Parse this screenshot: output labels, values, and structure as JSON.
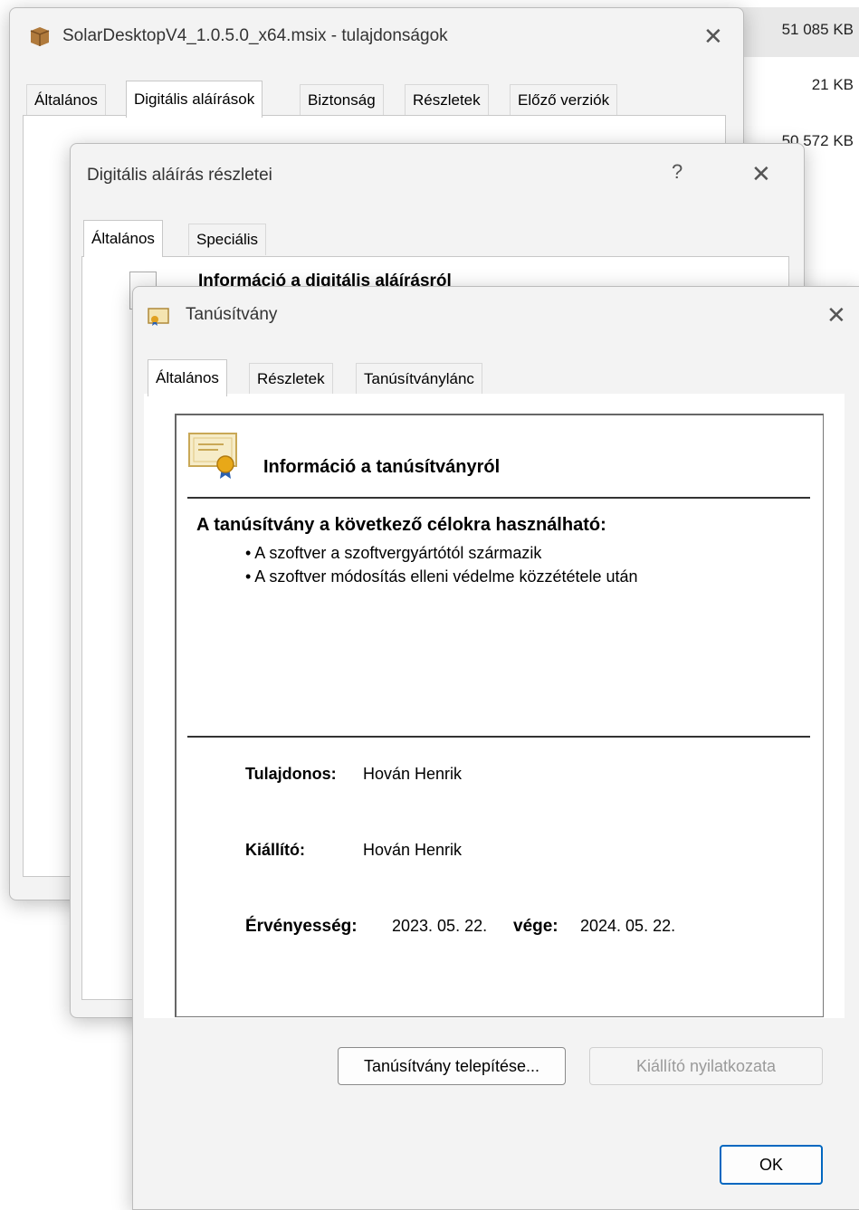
{
  "background_list": {
    "sizes": [
      "51 085 KB",
      "21 KB",
      "50 572 KB"
    ]
  },
  "props_window": {
    "title": "SolarDesktopV4_1.0.5.0_x64.msix - tulajdonságok",
    "tabs": [
      "Általános",
      "Digitális aláírások",
      "Biztonság",
      "Részletek",
      "Előző verziók"
    ],
    "active_tab": 1
  },
  "sig_window": {
    "title": "Digitális aláírás részletei",
    "help": "?",
    "tabs": [
      "Általános",
      "Speciális"
    ],
    "heading": "Információ a digitális aláírásról"
  },
  "cert_window": {
    "title": "Tanúsítvány",
    "tabs": [
      "Általános",
      "Részletek",
      "Tanúsítványlánc"
    ],
    "info_title": "Információ a tanúsítványról",
    "purpose_heading": "A tanúsítvány a következő célokra használható:",
    "purposes": [
      "• A szoftver a szoftvergyártótól származik",
      "• A szoftver módosítás elleni védelme közzététele után"
    ],
    "owner_label": "Tulajdonos:",
    "owner_value": "Hován Henrik",
    "issuer_label": "Kiállító:",
    "issuer_value": "Hován Henrik",
    "validity_label": "Érvényesség:",
    "valid_from": "2023. 05. 22.",
    "valid_to_label": "vége:",
    "valid_to": "2024. 05. 22.",
    "install_button": "Tanúsítvány telepítése...",
    "issuer_statement_button": "Kiállító nyilatkozata",
    "ok_button": "OK"
  },
  "colors": {
    "accent": "#0067c0",
    "window_bg": "#f3f3f3",
    "panel_bg": "#ffffff"
  }
}
